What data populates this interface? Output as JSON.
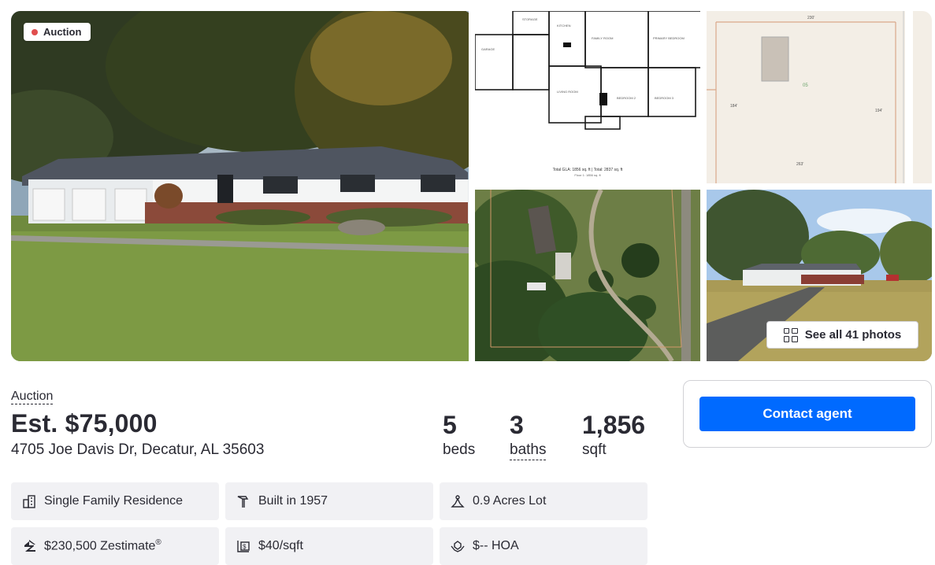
{
  "gallery": {
    "badge_label": "Auction",
    "see_all_label": "See all 41 photos"
  },
  "listing": {
    "status_label": "Auction",
    "price": "Est. $75,000",
    "address": "4705 Joe Davis Dr, Decatur, AL 35603",
    "beds_value": "5",
    "beds_label": "beds",
    "baths_value": "3",
    "baths_label": "baths",
    "sqft_value": "1,856",
    "sqft_label": "sqft"
  },
  "contact": {
    "button_label": "Contact agent"
  },
  "facts": {
    "type": "Single Family Residence",
    "built": "Built in 1957",
    "lot": "0.9 Acres Lot",
    "zestimate": "$230,500 Zestimate",
    "zestimate_mark": "®",
    "price_per_sqft": "$40/sqft",
    "hoa": "$-- HOA"
  },
  "icons": {
    "badge_dot": "status-dot",
    "see_all": "grid-icon",
    "type": "building-icon",
    "built": "hammer-icon",
    "lot": "lot-size-icon",
    "zestimate": "zillow-logo-icon",
    "price_per_sqft": "price-tag-icon",
    "hoa": "hoa-hands-icon"
  },
  "colors": {
    "accent": "#006aff",
    "badge_dot": "#e04e4e",
    "text": "#2a2a33",
    "fact_bg": "#f1f1f4"
  }
}
